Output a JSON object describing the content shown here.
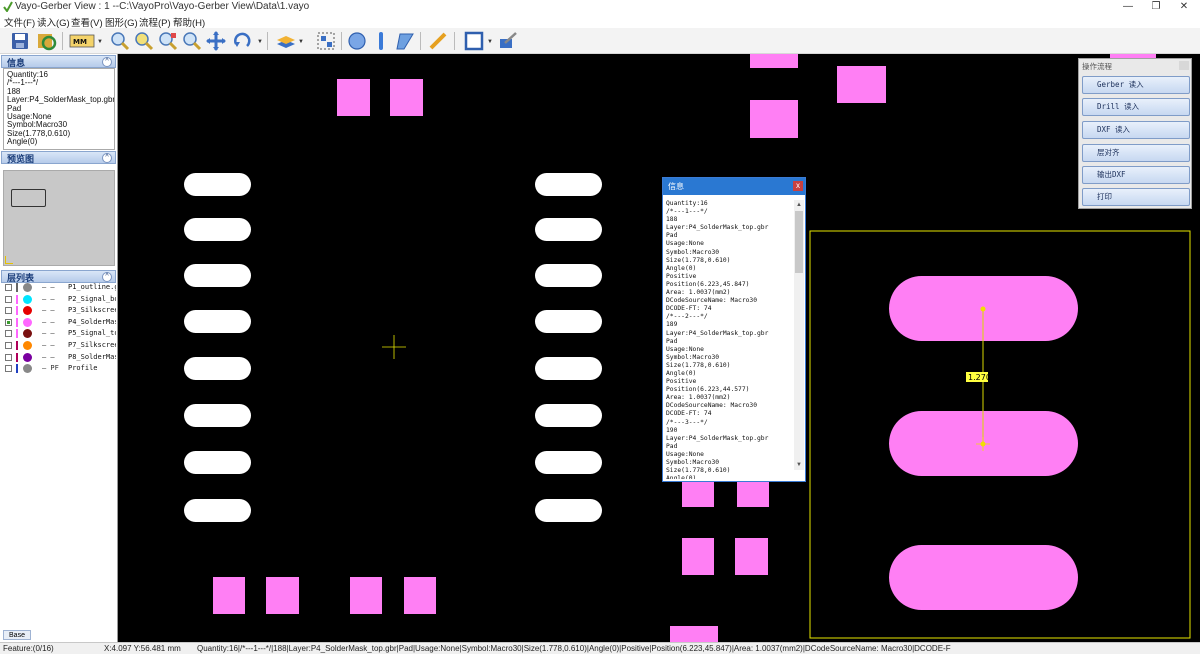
{
  "window": {
    "title": "Vayo-Gerber View : 1   --C:\\VayoPro\\Vayo-Gerber View\\Data\\1.vayo",
    "minimize": "—",
    "maximize": "❐",
    "close": "✕"
  },
  "menu": [
    "文件(F)",
    "读入(G)",
    "查看(V)",
    "图形(G)",
    "流程(P)",
    "帮助(H)"
  ],
  "toolbar": {
    "units_label": "MM"
  },
  "info_panel": {
    "title": "信息",
    "lines": [
      "Quantity:16",
      "/*---1---*/",
      "188",
      "Layer:P4_SolderMask_top.gbr",
      "Pad",
      "Usage:None",
      "Symbol:Macro30",
      "Size(1.778,0.610)",
      "Angle(0)"
    ]
  },
  "preview_panel": {
    "title": "预览图"
  },
  "layers_panel": {
    "title": "层列表",
    "layers": [
      {
        "name": "P1_outline.gb",
        "bar": "#666666",
        "dot": "#888888",
        "type": "— —",
        "checked": false
      },
      {
        "name": "P2_Signal_bo",
        "bar": "#ff66ff",
        "dot": "#00e5ff",
        "type": "— —",
        "checked": false
      },
      {
        "name": "P3_Silkscree",
        "bar": "#ff66ff",
        "dot": "#e60000",
        "type": "— —",
        "checked": false
      },
      {
        "name": "P4_SolderMask",
        "bar": "#ff66ff",
        "dot": "#ff66ff",
        "type": "— —",
        "checked": true
      },
      {
        "name": "P5_Signal_top",
        "bar": "#ff66ff",
        "dot": "#7a1010",
        "type": "— —",
        "checked": false
      },
      {
        "name": "P7_Silkscree",
        "bar": "#b0005a",
        "dot": "#ff8800",
        "type": "— —",
        "checked": false
      },
      {
        "name": "P8_SolderMask",
        "bar": "#b0005a",
        "dot": "#7a00a0",
        "type": "— —",
        "checked": false
      },
      {
        "name": "Profile",
        "bar": "#2040c0",
        "dot": "#888888",
        "type": "— PF",
        "checked": false
      }
    ],
    "base_tab": "Base"
  },
  "info_dialog": {
    "title": "信息",
    "close": "x",
    "lines": [
      "Quantity:16",
      "/*---1---*/",
      "188",
      "Layer:P4_SolderMask_top.gbr",
      "Pad",
      "Usage:None",
      "Symbol:Macro30",
      "Size(1.778,0.610)",
      "Angle(0)",
      "Positive",
      "Position(6.223,45.847)",
      "Area: 1.0037(mm2)",
      "DCodeSourceName: Macro30",
      "DCODE-FT: 74",
      "/*---2---*/",
      "189",
      "Layer:P4_SolderMask_top.gbr",
      "Pad",
      "Usage:None",
      "Symbol:Macro30",
      "Size(1.778,0.610)",
      "Angle(0)",
      "Positive",
      "Position(6.223,44.577)",
      "Area: 1.0037(mm2)",
      "DCodeSourceName: Macro30",
      "DCODE-FT: 74",
      "/*---3---*/",
      "190",
      "Layer:P4_SolderMask_top.gbr",
      "Pad",
      "Usage:None",
      "Symbol:Macro30",
      "Size(1.778,0.610)",
      "Angle(0)"
    ]
  },
  "flow_panel": {
    "title": "操作流程",
    "buttons": [
      "Gerber 读入",
      "Drill 读入",
      "DXF 读入",
      "层对齐",
      "输出DXF",
      "打印"
    ]
  },
  "measure_label": "1.270",
  "colors": {
    "pad_magenta": "#ff7ff4",
    "pad_white": "#ffffff",
    "selection_yellow": "#e6e600",
    "canvas_bg": "#000000"
  },
  "status": {
    "feature": "Feature:(0/16)",
    "coords": "X:4.097 Y:56.481 mm",
    "details": "Quantity:16|/*---1---*/|188|Layer:P4_SolderMask_top.gbr|Pad|Usage:None|Symbol:Macro30|Size(1.778,0.610)|Angle(0)|Positive|Position(6.223,45.847)|Area: 1.0037(mm2)|DCodeSourceName: Macro30|DCODE-F"
  }
}
